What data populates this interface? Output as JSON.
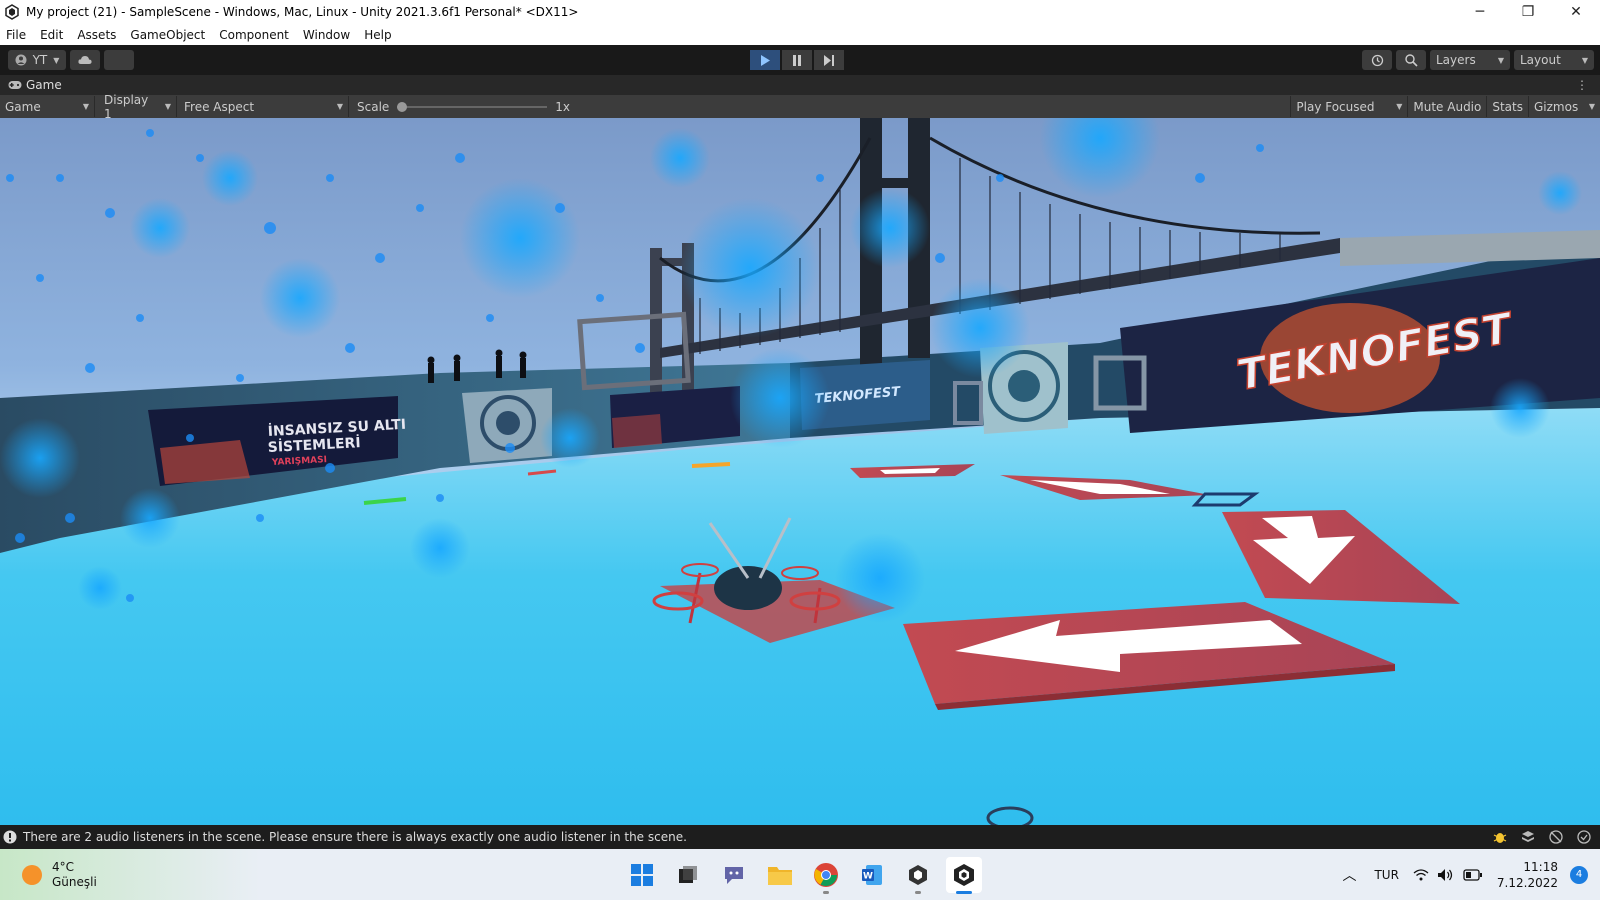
{
  "window": {
    "title": "My project (21) - SampleScene - Windows, Mac, Linux - Unity 2021.3.6f1 Personal* <DX11>",
    "minimize": "─",
    "restore": "❐",
    "close": "✕"
  },
  "menu": [
    "File",
    "Edit",
    "Assets",
    "GameObject",
    "Component",
    "Window",
    "Help"
  ],
  "toolbar": {
    "account_label": "YT",
    "layers_label": "Layers",
    "layout_label": "Layout"
  },
  "game_tab": {
    "label": "Game"
  },
  "game_toolbar": {
    "view_select": "Game",
    "display_select": "Display 1",
    "aspect_select": "Free Aspect",
    "scale_label": "Scale",
    "scale_value_label": "1x",
    "scale_value": 1,
    "play_focused": "Play Focused",
    "mute_audio": "Mute Audio",
    "stats": "Stats",
    "gizmos": "Gizmos"
  },
  "scene": {
    "left_banner_line1": "İNSANSIZ SU ALTI",
    "left_banner_line2": "SİSTEMLERİ",
    "left_banner_line3": "YARIŞMASI",
    "right_banner": "TEKNOFEST",
    "mid_banner": "TEKNOFEST"
  },
  "status": {
    "message": "There are 2 audio listeners in the scene. Please ensure there is always exactly one audio listener in the scene."
  },
  "taskbar": {
    "temp": "4°C",
    "weather": "Güneşli",
    "lang": "TUR",
    "time": "11:18",
    "date": "7.12.2022",
    "notifications": "4"
  },
  "colors": {
    "unity_dark": "#191919",
    "play_active": "#2d4f7c",
    "floor": "#38c7f0",
    "arrow_red": "#c0494e"
  }
}
